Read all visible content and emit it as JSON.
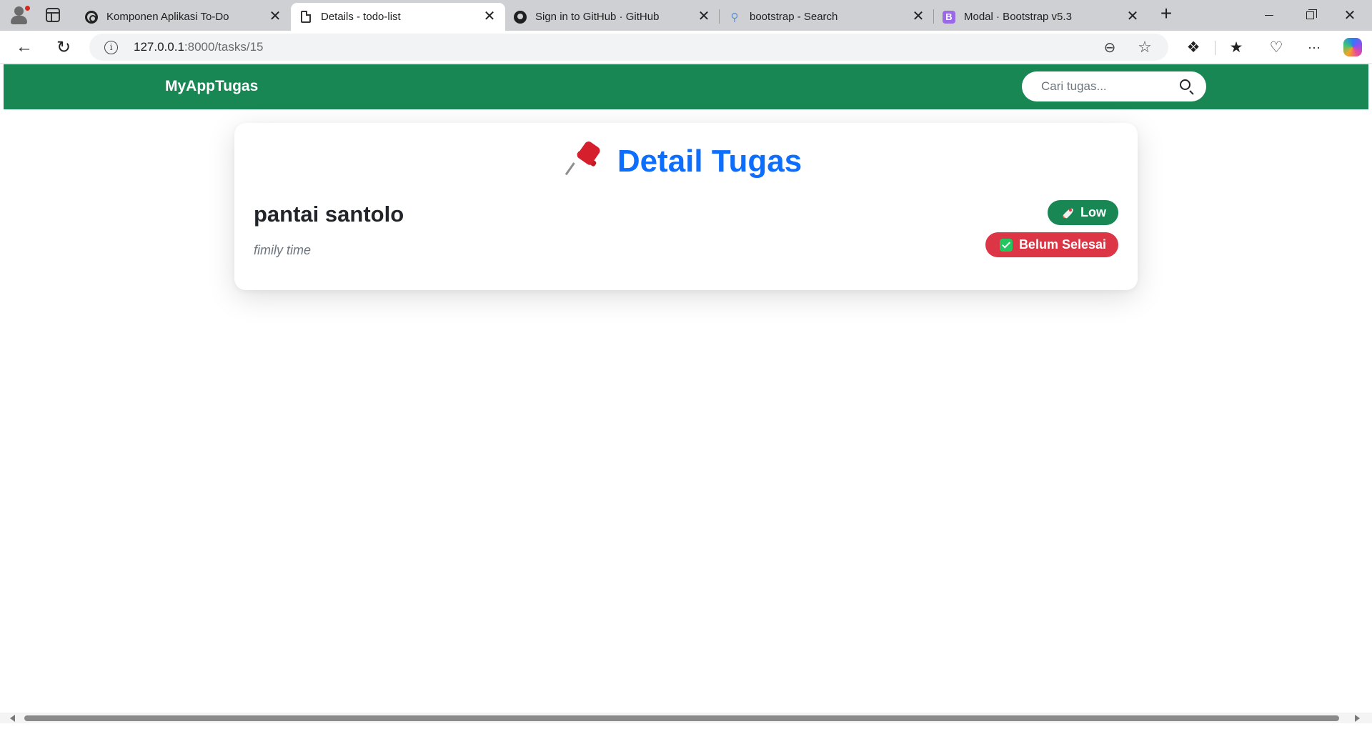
{
  "browser": {
    "tabs": [
      {
        "title": "Komponen Aplikasi To-Do",
        "icon": "openai-icon"
      },
      {
        "title": "Details - todo-list",
        "icon": "document-icon",
        "active": true
      },
      {
        "title": "Sign in to GitHub · GitHub",
        "icon": "github-icon"
      },
      {
        "title": "bootstrap - Search",
        "icon": "search-icon"
      },
      {
        "title": "Modal · Bootstrap v5.3",
        "icon": "bootstrap-icon"
      }
    ],
    "tab_close_glyph": "✕",
    "bootstrap_favicon_letter": "B",
    "address": {
      "host": "127.0.0.1",
      "path": ":8000/tasks/15"
    }
  },
  "navbar": {
    "brand": "MyAppTugas",
    "search_placeholder": "Cari tugas..."
  },
  "detail": {
    "heading": "Detail Tugas",
    "task_title": "pantai santolo",
    "task_description": "fimily time",
    "priority_badge": "Low",
    "status_badge": "Belum Selesai"
  },
  "colors": {
    "navbar_bg": "#198754",
    "heading": "#0d6efd",
    "badge_priority": "#198754",
    "badge_status": "#dc3545"
  }
}
